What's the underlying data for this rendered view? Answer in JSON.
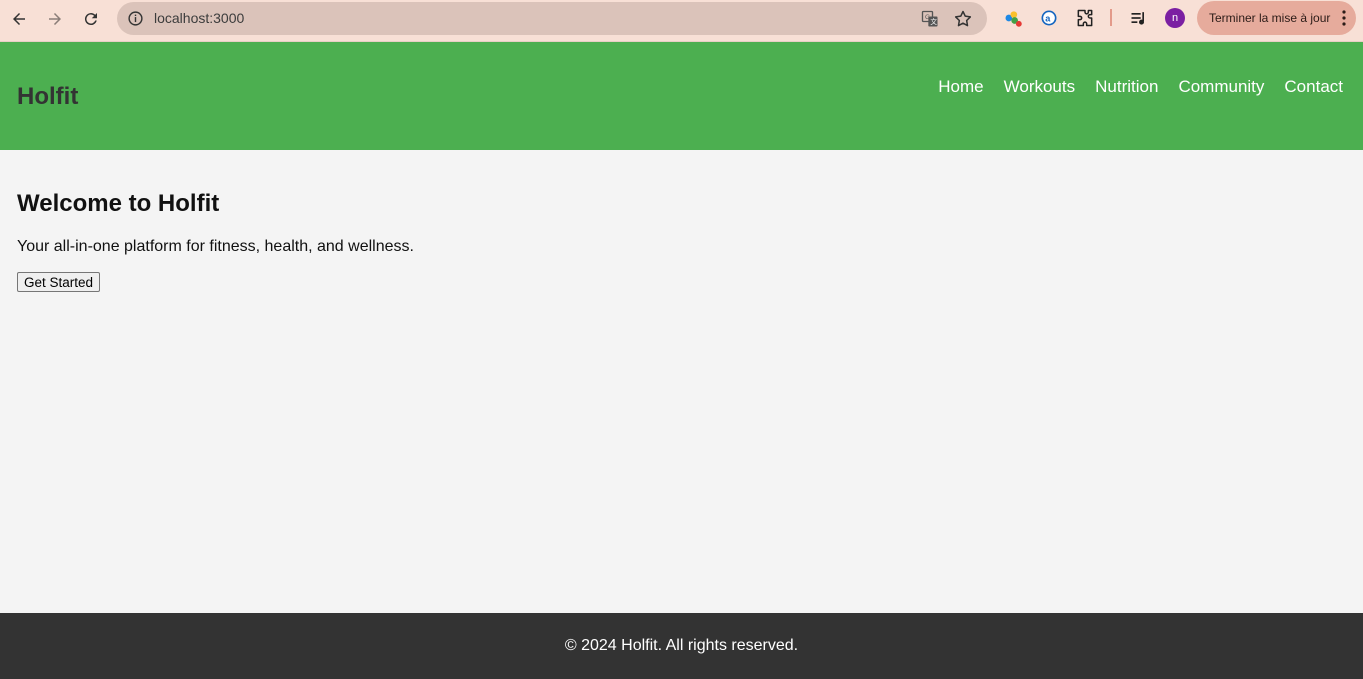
{
  "browser": {
    "url": "localhost:3000",
    "update_button_label": "Terminer la mise à jour",
    "profile_initial": "n",
    "icons": [
      "back-icon",
      "forward-icon",
      "reload-icon",
      "site-info-icon",
      "translate-icon",
      "bookmark-star-icon",
      "extension-colorful-icon",
      "extension-a-icon",
      "extensions-puzzle-icon",
      "media-control-icon",
      "more-vert-icon"
    ]
  },
  "site": {
    "logo": "Holfit",
    "nav": [
      "Home",
      "Workouts",
      "Nutrition",
      "Community",
      "Contact"
    ],
    "hero": {
      "title": "Welcome to Holfit",
      "subtitle": "Your all-in-one platform for fitness, health, and wellness.",
      "cta_label": "Get Started"
    },
    "footer": "© 2024 Holfit. All rights reserved.",
    "colors": {
      "header_bg": "#4caf50",
      "page_bg": "#f4f4f4",
      "footer_bg": "#333333",
      "logo_text": "#333333"
    }
  }
}
